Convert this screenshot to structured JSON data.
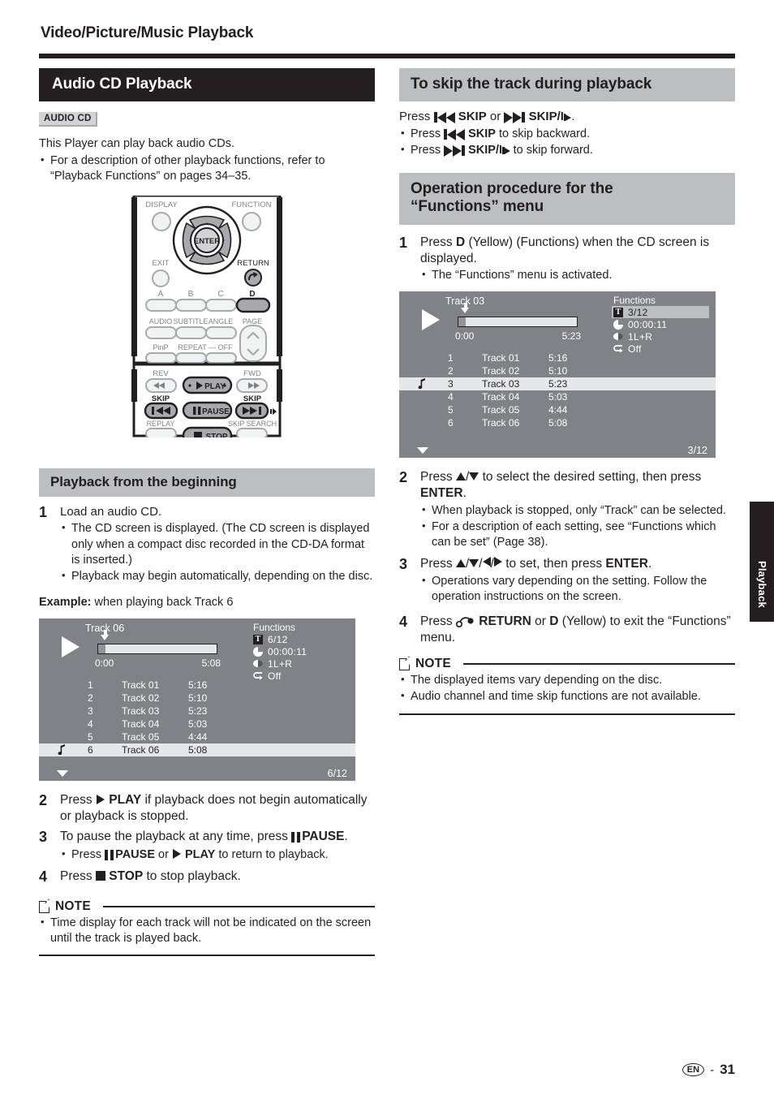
{
  "header": {
    "chapter_title": "Video/Picture/Music Playback"
  },
  "left": {
    "section_title": "Audio CD Playback",
    "badge": "AUDIO CD",
    "intro": "This Player can play back audio CDs.",
    "intro_bullets": [
      "For a description of other playback functions, refer to “Playback Functions” on pages 34–35."
    ],
    "remote": {
      "labels": {
        "display": "DISPLAY",
        "function": "FUNCTION",
        "enter": "ENTER",
        "exit": "EXIT",
        "return": "RETURN",
        "a": "A",
        "b": "B",
        "c": "C",
        "d": "D",
        "audio": "AUDIO",
        "subtitle": "SUBTITLE",
        "angle": "ANGLE",
        "page": "PAGE",
        "pinp": "PinP",
        "repeat": "REPEAT — OFF",
        "rev": "REV",
        "fwd": "FWD",
        "play": "PLAY",
        "pause": "PAUSE",
        "stop": "STOP",
        "skip_left": "SKIP",
        "skip_right": "SKIP",
        "replay": "REPLAY",
        "skip_search": "SKIP SEARCH"
      }
    },
    "subsection_title": "Playback from the beginning",
    "steps": [
      {
        "num": "1",
        "text": "Load an audio CD.",
        "bullets": [
          "The CD screen is displayed. (The CD screen is displayed only when a compact disc recorded in the CD-DA format is inserted.)",
          "Playback may begin automatically, depending on the disc."
        ]
      }
    ],
    "example_label": "Example:",
    "example_text": "when playing back Track 6",
    "step2_pre": "Press",
    "step2_play": "PLAY",
    "step2_post": "if playback does not begin automatically or playback is stopped.",
    "step2_num": "2",
    "step3_num": "3",
    "step3_pre": "To pause the playback at any time, press",
    "step3_pause": "PAUSE",
    "step3_post": ".",
    "step3_bullet_pre": "Press",
    "step3_bullet_pause": "PAUSE",
    "step3_bullet_or": "or",
    "step3_bullet_play": "PLAY",
    "step3_bullet_post": "to return to playback.",
    "step4_num": "4",
    "step4_pre": "Press",
    "step4_stop": "STOP",
    "step4_post": "to stop playback.",
    "note_label": "NOTE",
    "note_bullets": [
      "Time display for each track will not be indicated on the screen until the track is played back."
    ]
  },
  "right": {
    "skip_title": "To skip the track during playback",
    "skip_lead_pre": "Press",
    "skip_lead_mid": "SKIP",
    "skip_lead_or": "or",
    "skip_lead_end": "SKIP/I",
    "skip_bullets": [
      {
        "pre": "Press",
        "label": "SKIP",
        "post": "to skip backward."
      },
      {
        "pre": "Press",
        "label": "SKIP/I",
        "post": "to skip forward."
      }
    ],
    "functions_title_line1": "Operation procedure for the",
    "functions_title_line2": "“Functions” menu",
    "step1_num": "1",
    "step1_text_a": "Press",
    "step1_d": "D",
    "step1_text_b": "(Yellow) (Functions) when the CD screen is displayed.",
    "step1_bullets": [
      "The “Functions” menu is activated."
    ],
    "step2_num": "2",
    "step2_text_a": "Press",
    "step2_text_b": "to select the desired setting, then press",
    "step2_enter": "ENTER",
    "step2_text_c": ".",
    "step2_bullets": [
      "When playback is stopped, only “Track” can be selected.",
      "For a description of each setting, see “Functions which can be set” (Page 38)."
    ],
    "step3_num": "3",
    "step3_text_a": "Press",
    "step3_text_b": "to set, then press",
    "step3_enter": "ENTER",
    "step3_text_c": ".",
    "step3_bullets": [
      "Operations vary depending on the setting. Follow the operation instructions on the screen."
    ],
    "step4_num": "4",
    "step4_text_a": "Press",
    "step4_return": "RETURN",
    "step4_text_b": "or",
    "step4_d": "D",
    "step4_text_c": "(Yellow) to exit the “Functions” menu.",
    "note_label": "NOTE",
    "note_bullets": [
      "The displayed items vary depending on the disc.",
      "Audio channel and time skip functions are not available."
    ]
  },
  "cd_screen_left": {
    "track_label": "Track 06",
    "time_start": "0:00",
    "time_end": "5:08",
    "functions_title": "Functions",
    "functions": [
      {
        "icon": "track-icon",
        "value": "6/12",
        "highlight": false
      },
      {
        "icon": "clock-icon",
        "value": "00:00:11",
        "highlight": false
      },
      {
        "icon": "audio-icon",
        "value": "1",
        "value2": "L+R",
        "highlight": false
      },
      {
        "icon": "repeat-icon",
        "value": "Off",
        "highlight": false
      }
    ],
    "tracks": [
      {
        "num": "1",
        "title": "Track 01",
        "dur": "5:16",
        "playing": false
      },
      {
        "num": "2",
        "title": "Track 02",
        "dur": "5:10",
        "playing": false
      },
      {
        "num": "3",
        "title": "Track 03",
        "dur": "5:23",
        "playing": false
      },
      {
        "num": "4",
        "title": "Track 04",
        "dur": "5:03",
        "playing": false
      },
      {
        "num": "5",
        "title": "Track 05",
        "dur": "4:44",
        "playing": false
      },
      {
        "num": "6",
        "title": "Track 06",
        "dur": "5:08",
        "playing": true
      }
    ],
    "counter": "6/12"
  },
  "cd_screen_right": {
    "track_label": "Track 03",
    "time_start": "0:00",
    "time_end": "5:23",
    "functions_title": "Functions",
    "functions": [
      {
        "icon": "track-icon",
        "value": "3/12",
        "highlight": true
      },
      {
        "icon": "clock-icon",
        "value": "00:00:11",
        "highlight": false
      },
      {
        "icon": "audio-icon",
        "value": "1",
        "value2": "L+R",
        "highlight": false
      },
      {
        "icon": "repeat-icon",
        "value": "Off",
        "highlight": false
      }
    ],
    "tracks": [
      {
        "num": "1",
        "title": "Track 01",
        "dur": "5:16",
        "playing": false
      },
      {
        "num": "2",
        "title": "Track 02",
        "dur": "5:10",
        "playing": false
      },
      {
        "num": "3",
        "title": "Track 03",
        "dur": "5:23",
        "playing": true
      },
      {
        "num": "4",
        "title": "Track 04",
        "dur": "5:03",
        "playing": false
      },
      {
        "num": "5",
        "title": "Track 05",
        "dur": "4:44",
        "playing": false
      },
      {
        "num": "6",
        "title": "Track 06",
        "dur": "5:08",
        "playing": false
      }
    ],
    "counter": "3/12"
  },
  "side_tab": {
    "label": "Playback"
  },
  "footer": {
    "lang": "EN",
    "dash": "-",
    "page": "31"
  },
  "colors": {
    "dark": "#231f20",
    "banner_grey": "#bcbec0",
    "screen_grey": "#808285",
    "highlight": "#e6e7e8"
  }
}
